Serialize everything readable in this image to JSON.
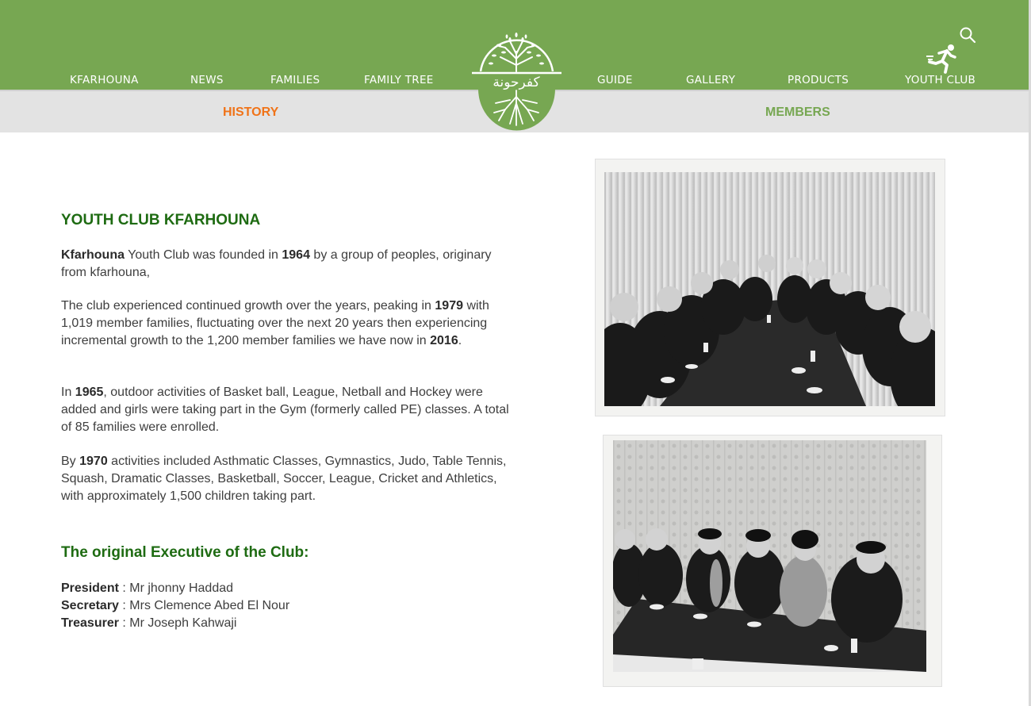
{
  "nav": {
    "items": [
      {
        "label": "KFARHOUNA"
      },
      {
        "label": "NEWS"
      },
      {
        "label": "FAMILIES"
      },
      {
        "label": "FAMILY TREE"
      },
      {
        "label": "GUIDE"
      },
      {
        "label": "GALLERY"
      },
      {
        "label": "PRODUCTS"
      },
      {
        "label": "YOUTH CLUB"
      }
    ],
    "logo_text": "كفرحونة",
    "search_icon": "search-icon",
    "runner_icon": "running-figure-icon"
  },
  "subnav": {
    "history": "HISTORY",
    "members": "MEMBERS",
    "active_color": "#f07318",
    "inactive_color": "#77a752"
  },
  "colors": {
    "brand_green": "#77a752",
    "heading_green": "#1e6b12",
    "subbar_gray": "#e3e3e3"
  },
  "content": {
    "title": "YOUTH CLUB KFARHOUNA",
    "p1": {
      "b1": "Kfarhouna",
      "t1": " Youth Club was founded in ",
      "b2": "1964",
      "t2": " by a group of peoples, originary from kfarhouna,"
    },
    "p2": {
      "t1": "The club experienced continued growth over the years, peaking in ",
      "b1": "1979",
      "t2": " with 1,019 member families, fluctuating over the next 20 years then experiencing incremental growth to the 1,200 member families we have now in ",
      "b2": "2016",
      "t3": "."
    },
    "p3": {
      "t1": "In ",
      "b1": "1965",
      "t2": ", outdoor activities of Basket ball, League, Netball and Hockey were added and girls were taking part in the Gym (formerly called PE) classes. A total of 85 families were enrolled."
    },
    "p4": {
      "t1": "By ",
      "b1": "1970",
      "t2": " activities included Asthmatic Classes, Gymnastics, Judo, Table Tennis, Squash, Dramatic Classes, Basketball, Soccer, League, Cricket and Athletics, with approximately 1,500 children taking part."
    },
    "exec_title": "The original Executive of the Club:",
    "executive": [
      {
        "role": "President",
        "sep": " : ",
        "name": "Mr jhonny Haddad"
      },
      {
        "role": "Secretary",
        "sep": " : ",
        "name": "Mrs Clemence Abed El Nour"
      },
      {
        "role": "Treasurer",
        "sep": " : ",
        "name": "Mr Joseph Kahwaji"
      }
    ]
  }
}
